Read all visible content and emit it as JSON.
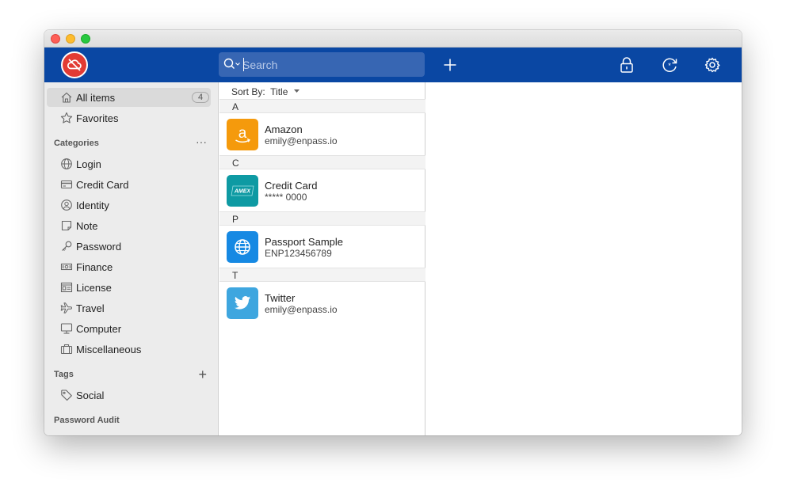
{
  "colors": {
    "toolbar": "#0a47a3",
    "logo": "#e23b34",
    "amazon": "#f59a0c",
    "credit_card": "#0e9aa3",
    "passport": "#1689e3",
    "twitter": "#3ea6df"
  },
  "toolbar": {
    "search_placeholder": "Search",
    "icons": [
      "search-icon",
      "add-icon",
      "lock-icon",
      "sync-icon",
      "gear-icon"
    ]
  },
  "sidebar": {
    "all_items": {
      "label": "All items",
      "count": "4",
      "icon": "home-icon"
    },
    "favorites": {
      "label": "Favorites",
      "icon": "star-icon"
    },
    "categories_header": "Categories",
    "categories_action": "···",
    "categories": [
      {
        "label": "Login",
        "icon": "globe-icon"
      },
      {
        "label": "Credit Card",
        "icon": "credit-card-icon"
      },
      {
        "label": "Identity",
        "icon": "identity-icon"
      },
      {
        "label": "Note",
        "icon": "note-icon"
      },
      {
        "label": "Password",
        "icon": "key-icon"
      },
      {
        "label": "Finance",
        "icon": "finance-icon"
      },
      {
        "label": "License",
        "icon": "license-icon"
      },
      {
        "label": "Travel",
        "icon": "plane-icon"
      },
      {
        "label": "Computer",
        "icon": "computer-icon"
      },
      {
        "label": "Miscellaneous",
        "icon": "briefcase-icon"
      }
    ],
    "tags_header": "Tags",
    "tags_action": "+",
    "tags": [
      {
        "label": "Social",
        "icon": "tag-icon"
      }
    ],
    "audit_header": "Password Audit"
  },
  "list": {
    "sort_label": "Sort By:",
    "sort_value": "Title",
    "groups": [
      {
        "letter": "A",
        "items": [
          {
            "title": "Amazon",
            "subtitle": "emily@enpass.io",
            "icon": "amazon-icon"
          }
        ]
      },
      {
        "letter": "C",
        "items": [
          {
            "title": "Credit Card",
            "subtitle": "***** 0000",
            "icon": "amex-card-icon",
            "badge": "AMEX"
          }
        ]
      },
      {
        "letter": "P",
        "items": [
          {
            "title": "Passport Sample",
            "subtitle": "ENP123456789",
            "icon": "globe-icon"
          }
        ]
      },
      {
        "letter": "T",
        "items": [
          {
            "title": "Twitter",
            "subtitle": "emily@enpass.io",
            "icon": "twitter-bird-icon"
          }
        ]
      }
    ]
  }
}
